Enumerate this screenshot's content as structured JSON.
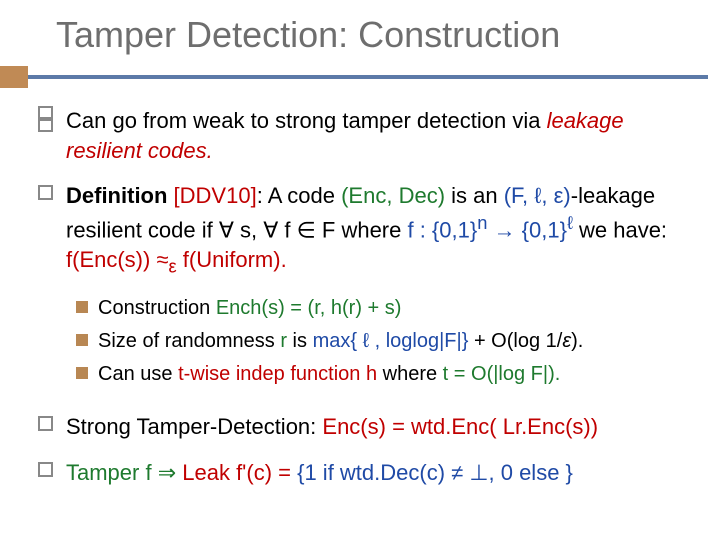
{
  "title": "Tamper Detection: Construction",
  "b1": {
    "t0": "Can go from weak to strong tamper detection via ",
    "t1": "leakage resilient codes."
  },
  "b2": {
    "t0": "Definition ",
    "ref": "[DDV10]",
    "t1": ": A code ",
    "code": "(Enc, Dec)",
    "t2": " is an ",
    "params": "(F, ℓ, ε)",
    "t3": "-leakage resilient code if ∀ s, ∀ f ∈ F where ",
    "fmap1": "f : {0,1}",
    "sup_n": "n",
    "arrow": " → ",
    "fmap2": "{0,1}",
    "sup_l": "ℓ",
    "t4": " we have:",
    "line2a": "f(Enc(s)) ≈",
    "subeps": "ε",
    "line2b": " f(Uniform)."
  },
  "sub1": {
    "t0": "Construction   ",
    "formula": "Ench(s) = (r, h(r) + s)"
  },
  "sub2": {
    "t0": "Size of randomness ",
    "r": "r",
    "t1": " is ",
    "max": "max{ ℓ , loglog|F|}",
    "t2": "  + O(log 1/",
    "eps": "ε",
    "t3": ")."
  },
  "sub3": {
    "t0": "Can use ",
    "twise": "t-wise indep function h",
    "t1": " where ",
    "teq": "t = O(|log F|)."
  },
  "b3": {
    "t0": "Strong Tamper-Detection: ",
    "enc": "Enc(s) = wtd.Enc( Lr.Enc(s))"
  },
  "b4": {
    "a": "Tamper f ⇒ ",
    "b": "Leak f'(c) = ",
    "c": "{1 if wtd.Dec(c) ≠ ⊥, 0 else }"
  }
}
